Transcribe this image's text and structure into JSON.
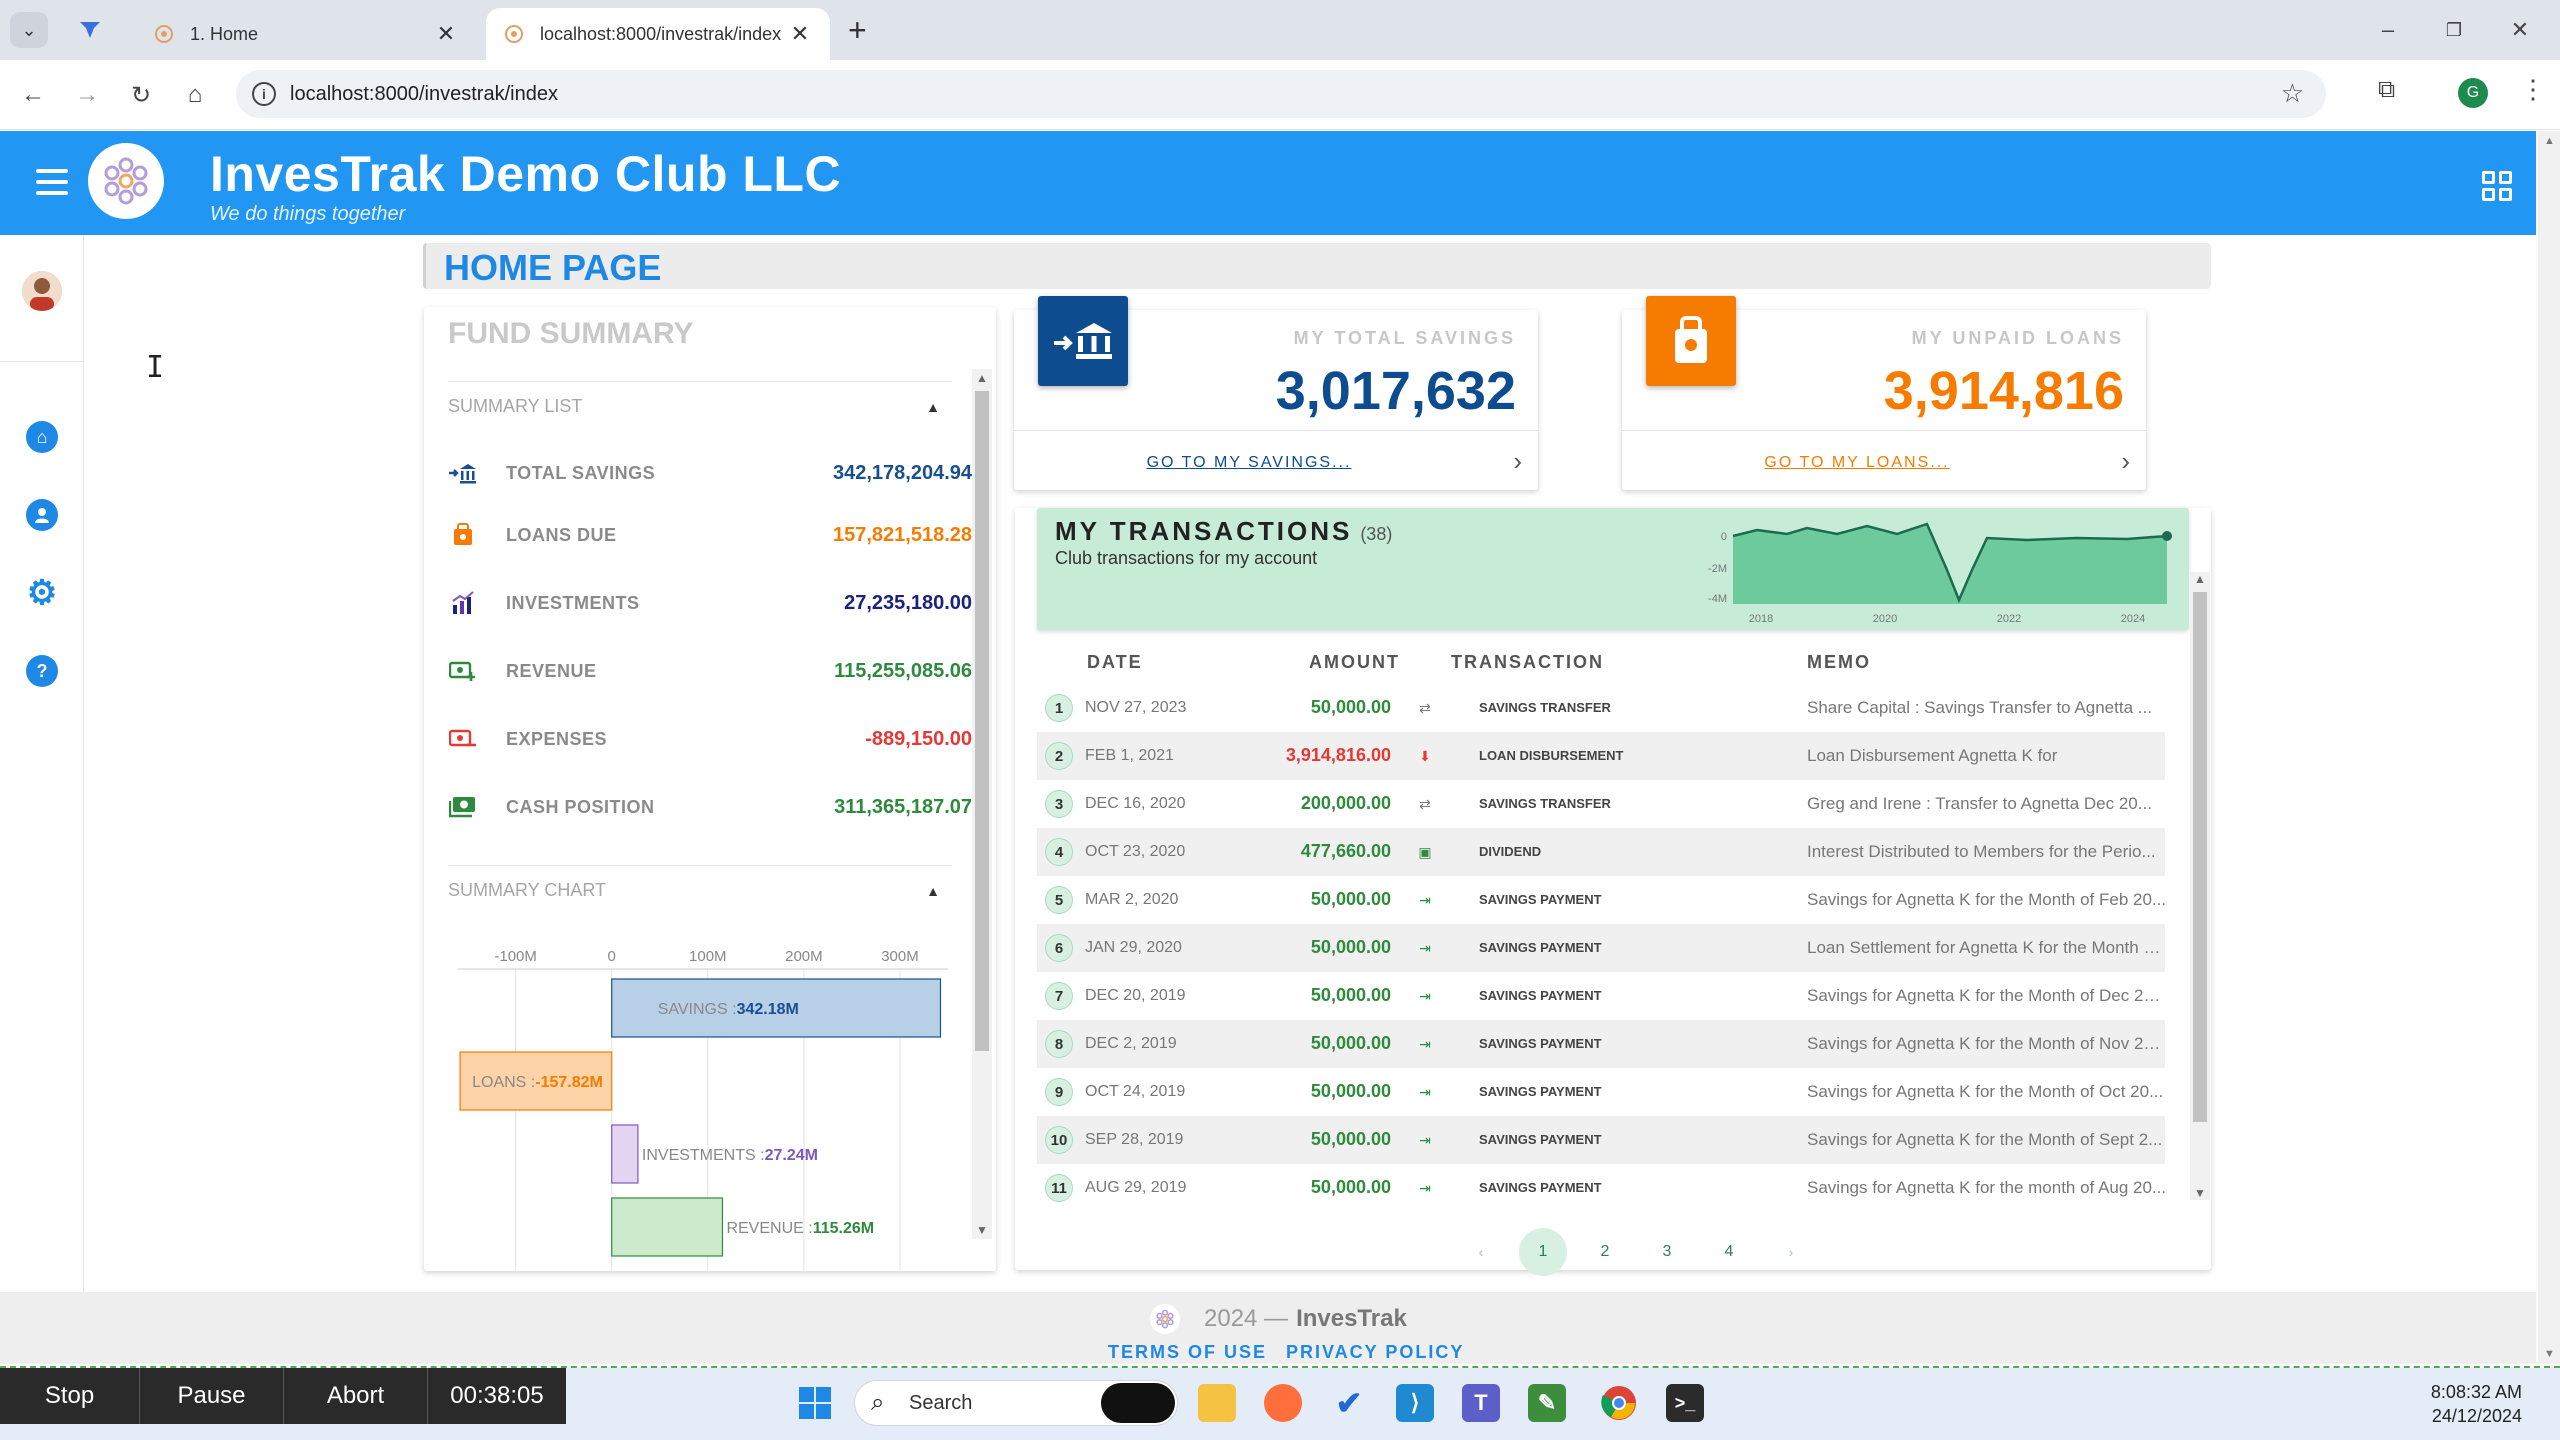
{
  "browser": {
    "tabs": [
      {
        "title": "1. Home",
        "active": false
      },
      {
        "title": "localhost:8000/investrak/index",
        "active": true
      }
    ],
    "url": "localhost:8000/investrak/index",
    "profile_initial": "G"
  },
  "app": {
    "title": "InvesTrak Demo Club LLC",
    "tagline": "We do things together",
    "page_title": "HOME PAGE"
  },
  "fund_summary": {
    "title": "FUND SUMMARY",
    "list_header": "SUMMARY LIST",
    "chart_header": "SUMMARY CHART",
    "rows": [
      {
        "label": "TOTAL SAVINGS",
        "value": "342,178,204.94",
        "color": "#1a4f8f",
        "icon": "bank-icon"
      },
      {
        "label": "LOANS DUE",
        "value": "157,821,518.28",
        "color": "#f57c00",
        "icon": "loan-icon"
      },
      {
        "label": "INVESTMENTS",
        "value": "27,235,180.00",
        "color": "#1a237e",
        "icon": "investments-icon"
      },
      {
        "label": "REVENUE",
        "value": "115,255,085.06",
        "color": "#2e8b3e",
        "icon": "revenue-icon"
      },
      {
        "label": "EXPENSES",
        "value": "-889,150.00",
        "color": "#e53935",
        "icon": "expenses-icon"
      },
      {
        "label": "CASH POSITION",
        "value": "311,365,187.07",
        "color": "#2e8b3e",
        "icon": "cash-icon"
      }
    ]
  },
  "chart_data": {
    "type": "bar",
    "orientation": "horizontal",
    "categories": [
      "SAVINGS",
      "LOANS",
      "INVESTMENTS",
      "REVENUE"
    ],
    "values": [
      342.18,
      -157.82,
      27.24,
      115.26
    ],
    "data_labels": [
      "342.18M",
      "-157.82M",
      "27.24M",
      "115.26M"
    ],
    "x_ticks": [
      "-100M",
      "0",
      "100M",
      "200M",
      "300M"
    ],
    "xlim": [
      -160,
      350
    ],
    "colors": [
      "#b7d0e8",
      "#fdd3a8",
      "#e3d5f2",
      "#cdeacd"
    ],
    "label_colors": [
      "#1a4f8f",
      "#f57c00",
      "#7e57c2",
      "#2e8b3e"
    ],
    "grid": true
  },
  "savings_card": {
    "label": "MY TOTAL SAVINGS",
    "value": "3,017,632",
    "link": "GO TO MY SAVINGS...",
    "color": "#0d4c8f"
  },
  "loans_card": {
    "label": "MY UNPAID LOANS",
    "value": "3,914,816",
    "link": "GO TO MY LOANS...",
    "color": "#f57c00"
  },
  "transactions": {
    "title": "MY TRANSACTIONS",
    "count": "(38)",
    "subtitle": "Club transactions for my account",
    "spark_y_ticks": [
      "0",
      "-2M",
      "-4M"
    ],
    "spark_x_ticks": [
      "2018",
      "2020",
      "2022",
      "2024"
    ],
    "columns": [
      "DATE",
      "AMOUNT",
      "TRANSACTION",
      "MEMO"
    ],
    "rows": [
      {
        "n": "1",
        "date": "NOV 27, 2023",
        "amount": "50,000.00",
        "type": "SAVINGS TRANSFER",
        "memo": "Share Capital : Savings Transfer to Agnetta ...",
        "amount_color": "#2e8b3e",
        "icon": "transfer-icon"
      },
      {
        "n": "2",
        "date": "FEB 1, 2021",
        "amount": "3,914,816.00",
        "type": "LOAN DISBURSEMENT",
        "memo": "Loan Disbursement Agnetta K for",
        "amount_color": "#e53935",
        "icon": "loan-disbursement-icon"
      },
      {
        "n": "3",
        "date": "DEC 16, 2020",
        "amount": "200,000.00",
        "type": "SAVINGS TRANSFER",
        "memo": "Greg and Irene : Transfer to Agnetta Dec 20...",
        "amount_color": "#2e8b3e",
        "icon": "transfer-icon"
      },
      {
        "n": "4",
        "date": "OCT 23, 2020",
        "amount": "477,660.00",
        "type": "DIVIDEND",
        "memo": "Interest Distributed to Members for the Perio...",
        "amount_color": "#2e8b3e",
        "icon": "dividend-icon"
      },
      {
        "n": "5",
        "date": "MAR 2, 2020",
        "amount": "50,000.00",
        "type": "SAVINGS PAYMENT",
        "memo": "Savings for Agnetta K for the Month of Feb 20...",
        "amount_color": "#2e8b3e",
        "icon": "savings-payment-icon"
      },
      {
        "n": "6",
        "date": "JAN 29, 2020",
        "amount": "50,000.00",
        "type": "SAVINGS PAYMENT",
        "memo": "Loan Settlement for Agnetta K for the Month o...",
        "amount_color": "#2e8b3e",
        "icon": "savings-payment-icon"
      },
      {
        "n": "7",
        "date": "DEC 20, 2019",
        "amount": "50,000.00",
        "type": "SAVINGS PAYMENT",
        "memo": "Savings for Agnetta K for the Month of Dec 20...",
        "amount_color": "#2e8b3e",
        "icon": "savings-payment-icon"
      },
      {
        "n": "8",
        "date": "DEC 2, 2019",
        "amount": "50,000.00",
        "type": "SAVINGS PAYMENT",
        "memo": "Savings for Agnetta K for the Month of Nov 20...",
        "amount_color": "#2e8b3e",
        "icon": "savings-payment-icon"
      },
      {
        "n": "9",
        "date": "OCT 24, 2019",
        "amount": "50,000.00",
        "type": "SAVINGS PAYMENT",
        "memo": "Savings for Agnetta K for the Month of Oct 20...",
        "amount_color": "#2e8b3e",
        "icon": "savings-payment-icon"
      },
      {
        "n": "10",
        "date": "SEP 28, 2019",
        "amount": "50,000.00",
        "type": "SAVINGS PAYMENT",
        "memo": "Savings for Agnetta K for the Month of Sept 2...",
        "amount_color": "#2e8b3e",
        "icon": "savings-payment-icon"
      },
      {
        "n": "11",
        "date": "AUG 29, 2019",
        "amount": "50,000.00",
        "type": "SAVINGS PAYMENT",
        "memo": "Savings for Agnetta K for the month of Aug 20...",
        "amount_color": "#2e8b3e",
        "icon": "savings-payment-icon"
      }
    ],
    "pages": [
      "1",
      "2",
      "3",
      "4"
    ],
    "current_page": "1"
  },
  "footer": {
    "year": "2024 —",
    "brand": "InvesTrak",
    "terms": "TERMS OF USE",
    "privacy": "PRIVACY POLICY"
  },
  "taskbar": {
    "stop": "Stop",
    "pause": "Pause",
    "abort": "Abort",
    "timer": "00:38:05",
    "search_placeholder": "Search",
    "time": "8:08:32 AM",
    "date": "24/12/2024"
  }
}
